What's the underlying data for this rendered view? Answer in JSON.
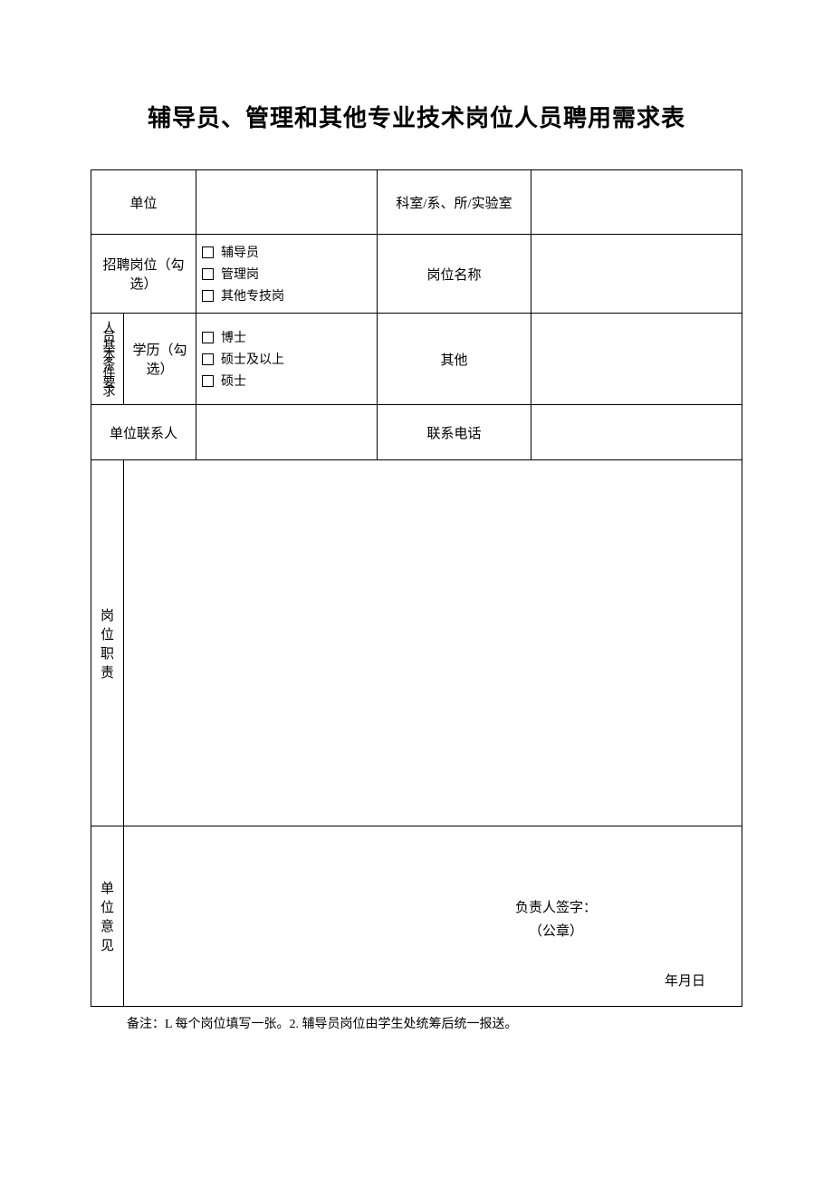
{
  "title": "辅导员、管理和其他专业技术岗位人员聘用需求表",
  "labels": {
    "unit": "单位",
    "dept": "科室/系、所/实验室",
    "recruit_position": "招聘岗位（勾选）",
    "position_name": "岗位名称",
    "basic_req": "人员基本条件要求",
    "education": "学历（勾选）",
    "other": "其他",
    "contact": "单位联系人",
    "phone": "联系电话",
    "duties": "岗位职责",
    "opinion": "单位意见",
    "sign": "负责人签字：",
    "seal": "（公章）",
    "date": "年月日"
  },
  "checkboxes": {
    "pos": [
      "辅导员",
      "管理岗",
      "其他专技岗"
    ],
    "edu": [
      "博士",
      "硕士及以上",
      "硕士"
    ]
  },
  "values": {
    "unit": "",
    "dept": "",
    "position_name": "",
    "other": "",
    "contact": "",
    "phone": "",
    "duties": "",
    "opinion": ""
  },
  "note": "备注：L 每个岗位填写一张。2. 辅导员岗位由学生处统筹后统一报送。"
}
